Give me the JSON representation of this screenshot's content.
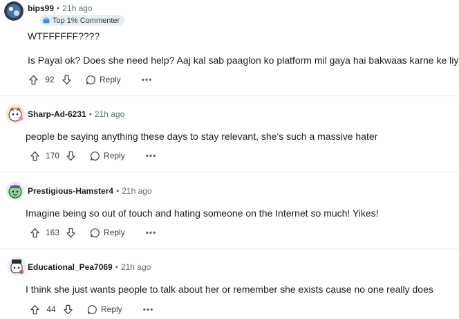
{
  "comments": [
    {
      "username": "bips99",
      "separator": "•",
      "time": "21h ago",
      "flair": "Top 1% Commenter",
      "lines": [
        "WTFFFFFF????",
        "Is Payal ok? Does she need help? Aaj kal sab paaglon ko platform mil gaya hai bakwaas karne ke liye"
      ],
      "score": "92",
      "reply_label": "Reply",
      "more_label": "•••"
    },
    {
      "username": "Sharp-Ad-6231",
      "separator": "•",
      "time": "21h ago",
      "lines": [
        "people be saying anything these days to stay relevant, she's such a massive hater"
      ],
      "score": "170",
      "reply_label": "Reply",
      "more_label": "•••"
    },
    {
      "username": "Prestigious-Hamster4",
      "separator": "•",
      "time": "21h ago",
      "lines": [
        "Imagine being so out of touch and hating someone on the Internet so much! Yikes!"
      ],
      "score": "163",
      "reply_label": "Reply",
      "more_label": "•••"
    },
    {
      "username": "Educational_Pea7069",
      "separator": "•",
      "time": "21h ago",
      "lines": [
        "I think she just wants people to talk about her or remember she exists cause no one really does"
      ],
      "score": "44",
      "reply_label": "Reply",
      "more_label": "•••"
    }
  ],
  "icons": {
    "upvote": "upvote-arrow-icon",
    "downvote": "downvote-arrow-icon",
    "reply": "speech-bubble-icon",
    "flair": "commenter-badge-icon"
  }
}
